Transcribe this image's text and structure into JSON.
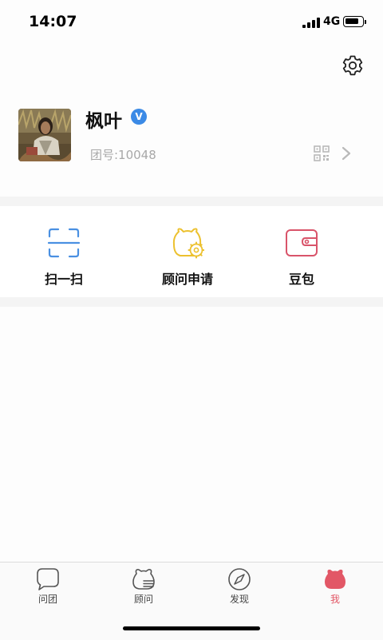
{
  "status_bar": {
    "time": "14:07",
    "network": "4G",
    "battery_level": 0.75
  },
  "header": {
    "settings_icon": "gear-icon"
  },
  "profile": {
    "name": "枫叶",
    "verified_badge": "V",
    "group_id": "团号:10048",
    "qr_icon": "qr-code-icon",
    "chevron_icon": "chevron-right-icon"
  },
  "actions": [
    {
      "label": "扫一扫",
      "icon": "scan-icon",
      "color": "#4a90e2"
    },
    {
      "label": "顾问申请",
      "icon": "bear-gear-icon",
      "color": "#ecc12f"
    },
    {
      "label": "豆包",
      "icon": "wallet-icon",
      "color": "#d9546a"
    }
  ],
  "tab_bar": {
    "items": [
      {
        "label": "问团",
        "icon": "chat-bubble-icon"
      },
      {
        "label": "顾问",
        "icon": "bear-icon"
      },
      {
        "label": "发现",
        "icon": "compass-icon"
      },
      {
        "label": "我",
        "icon": "bear-filled-icon"
      }
    ],
    "active_index": 3,
    "active_color": "#e25766"
  }
}
